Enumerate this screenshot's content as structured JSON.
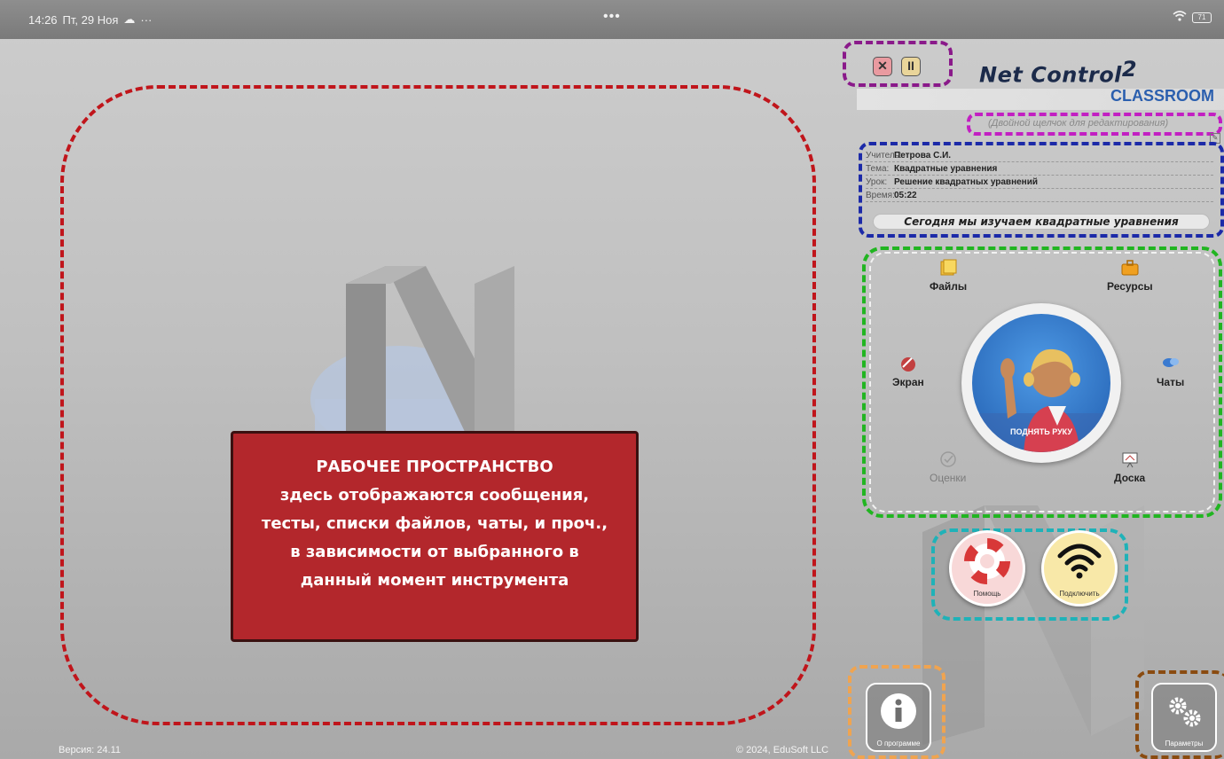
{
  "statusbar": {
    "time": "14:26",
    "date": "Пт, 29 Ноя",
    "more": "···",
    "center_dots": "•••",
    "battery": "71"
  },
  "workspace": {
    "lines": [
      "РАБОЧЕЕ ПРОСТРАНСТВО",
      "здесь отображаются сообщения,",
      "тесты, списки файлов, чаты, и проч.,",
      "в зависимости от выбранного в",
      "данный момент инструмента"
    ]
  },
  "footer": {
    "version": "Версия: 24.11",
    "copyright": "© 2024, EduSoft LLC"
  },
  "brand": {
    "name": "Net Control",
    "sup": "2",
    "sub": "CLASSROOM"
  },
  "edit_hint": "(Двойной щелчок для редактирования)",
  "info": {
    "teacher_key": "Учитель:",
    "teacher": "Петрова С.И.",
    "topic_key": "Тема:",
    "topic": "Квадратные уравнения",
    "lesson_key": "Урок:",
    "lesson": "Решение квадратных уравнений",
    "time_key": "Время:",
    "time": "05:22",
    "message": "Сегодня мы изучаем квадратные уравнения"
  },
  "tools": {
    "files": "Файлы",
    "resources": "Ресурсы",
    "screen": "Экран",
    "chats": "Чаты",
    "grades": "Оценки",
    "board": "Доска",
    "raise_hand": "ПОДНЯТЬ РУКУ"
  },
  "buttons": {
    "help": "Помощь",
    "connect": "Подключить",
    "about": "О программе",
    "settings": "Параметры"
  },
  "colors": {
    "workspace_border": "#c0151b",
    "workspace_card": "#b3272c",
    "control_border": "#8a1a8a",
    "edit_border": "#c21fc2",
    "info_border": "#1c2aa8",
    "tools_border": "#21b521",
    "round_border": "#1fb2b8",
    "about_border": "#f0a450",
    "settings_border": "#8a4b10"
  }
}
